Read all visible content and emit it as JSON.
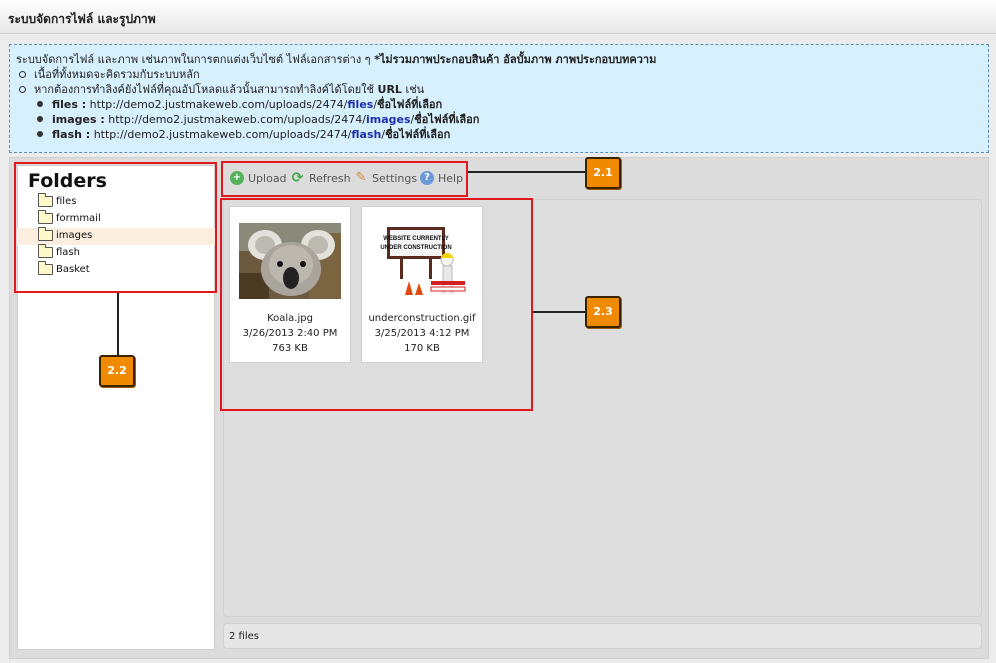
{
  "window": {
    "title": "ระบบจัดการไฟล์ และรูปภาพ"
  },
  "info": {
    "intro": "ระบบจัดการไฟล์ และภาพ เช่นภาพในการตกแต่งเว็บไซต์ ไฟล์เอกสารต่าง ๆ",
    "intro_bold": "*ไม่รวมภาพประกอบสินค้า อัลบั้มภาพ ภาพประกอบบทความ",
    "point1": "เนื้อที่ทั้งหมดจะคิดรวมกับระบบหลัก",
    "point2_pre": "หากต้องการทำลิงค์ยังไฟล์ที่คุณอัปโหลดแล้วนั้นสามารถทำลิงค์ได้โดยใช้",
    "point2_bold": "URL",
    "point2_post": "เช่น",
    "urls": [
      {
        "label": "files :",
        "base": "http://demo2.justmakeweb.com/uploads/2474/",
        "folder": "files",
        "sep": "/",
        "tail": "ชื่อไฟล์ที่เลือก"
      },
      {
        "label": "images :",
        "base": "http://demo2.justmakeweb.com/uploads/2474/",
        "folder": "images",
        "sep": "/",
        "tail": "ชื่อไฟล์ที่เลือก"
      },
      {
        "label": "flash :",
        "base": "http://demo2.justmakeweb.com/uploads/2474/",
        "folder": "flash",
        "sep": "/",
        "tail": "ชื่อไฟล์ที่เลือก"
      }
    ]
  },
  "folders": {
    "title": "Folders",
    "items": [
      {
        "label": "files",
        "selected": false
      },
      {
        "label": "formmail",
        "selected": false
      },
      {
        "label": "images",
        "selected": true
      },
      {
        "label": "flash",
        "selected": false
      },
      {
        "label": "Basket",
        "selected": false
      }
    ]
  },
  "toolbar": {
    "upload": {
      "label": "Upload",
      "icon": "upload-icon",
      "color": "#4caf50"
    },
    "refresh": {
      "label": "Refresh",
      "icon": "refresh-icon",
      "color": "#3fa84a"
    },
    "settings": {
      "label": "Settings",
      "icon": "wrench-icon",
      "color": "#d08a3a"
    },
    "help": {
      "label": "Help",
      "icon": "help-icon",
      "color": "#5b8ed6"
    }
  },
  "files": [
    {
      "name": "Koala.jpg",
      "date": "3/26/2013 2:40 PM",
      "size": "763 KB"
    },
    {
      "name": "underconstruction.gif",
      "date": "3/25/2013 4:12 PM",
      "size": "170 KB",
      "sign_line1": "WEBSITE CURRENTLY",
      "sign_line2": "UNDER CONSTRUCTION"
    }
  ],
  "status": {
    "count": "2 files"
  },
  "callouts": [
    {
      "label": "2.1"
    },
    {
      "label": "2.2"
    },
    {
      "label": "2.3"
    }
  ],
  "colors": {
    "accent_red": "#e01820",
    "badge_orange": "#f08a00",
    "info_bg": "#d6f0fd",
    "link_blue": "#1c2fb0"
  }
}
